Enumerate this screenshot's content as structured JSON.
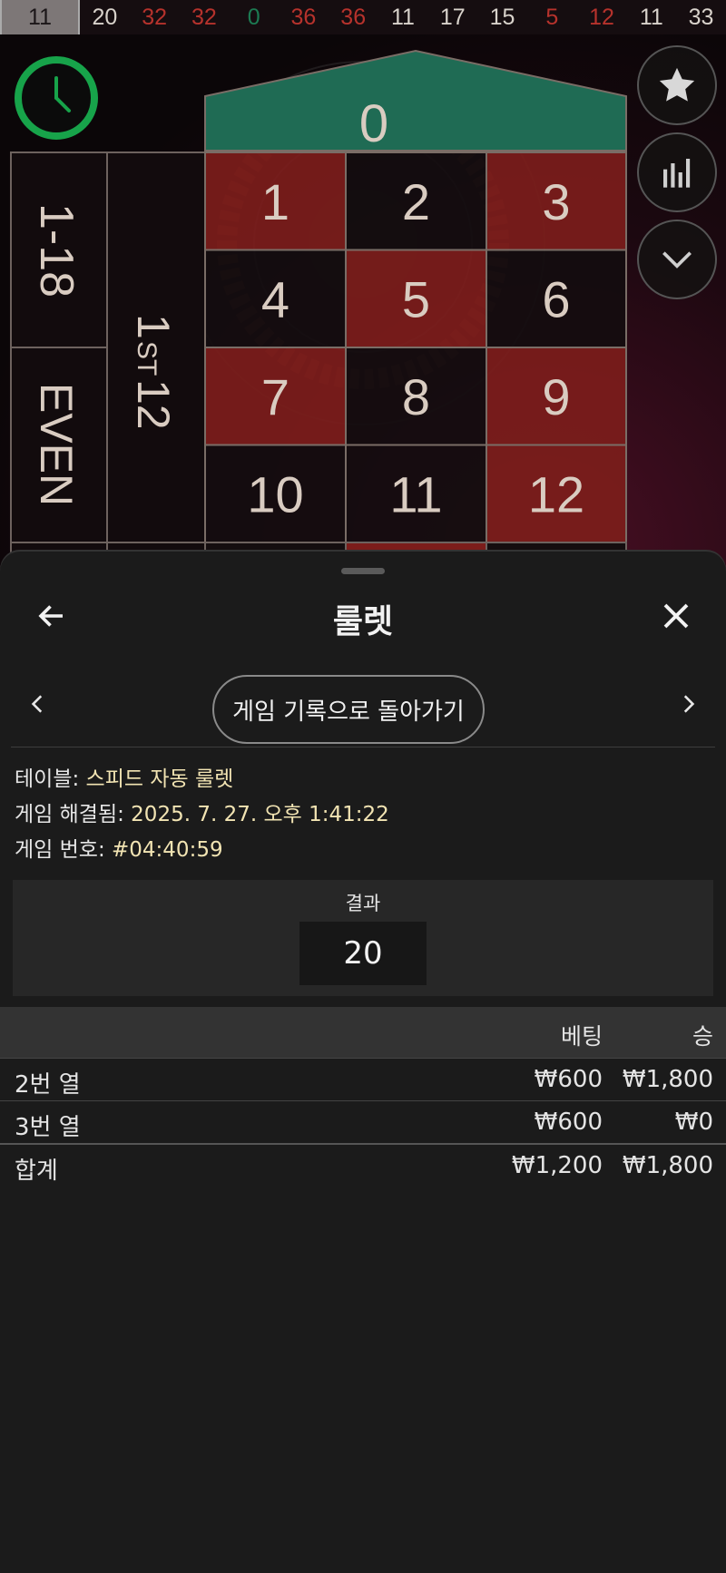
{
  "history": {
    "numbers": [
      {
        "value": "11",
        "color": "black"
      },
      {
        "value": "20",
        "color": "black"
      },
      {
        "value": "32",
        "color": "red"
      },
      {
        "value": "32",
        "color": "red"
      },
      {
        "value": "0",
        "color": "green"
      },
      {
        "value": "36",
        "color": "red"
      },
      {
        "value": "36",
        "color": "red"
      },
      {
        "value": "11",
        "color": "black"
      },
      {
        "value": "17",
        "color": "black"
      },
      {
        "value": "15",
        "color": "black"
      },
      {
        "value": "5",
        "color": "red"
      },
      {
        "value": "12",
        "color": "red"
      },
      {
        "value": "11",
        "color": "black"
      },
      {
        "value": "33",
        "color": "black"
      }
    ]
  },
  "table": {
    "zero": "0",
    "numbers": [
      {
        "n": "1",
        "color": "red"
      },
      {
        "n": "2",
        "color": "black"
      },
      {
        "n": "3",
        "color": "red"
      },
      {
        "n": "4",
        "color": "black"
      },
      {
        "n": "5",
        "color": "red"
      },
      {
        "n": "6",
        "color": "black"
      },
      {
        "n": "7",
        "color": "red"
      },
      {
        "n": "8",
        "color": "black"
      },
      {
        "n": "9",
        "color": "red"
      },
      {
        "n": "10",
        "color": "black"
      },
      {
        "n": "11",
        "color": "black"
      },
      {
        "n": "12",
        "color": "red"
      }
    ],
    "outside_low": "1-18",
    "outside_even": "EVEN",
    "dozen_number": "1",
    "dozen_suffix": "ST",
    "dozen_rest": "12",
    "colors": {
      "red": "#7c1d1b",
      "black": "#140d0f",
      "green": "#1f6b54",
      "accent": "#17a34a"
    }
  },
  "side_buttons": [
    "star-icon",
    "statistics-icon",
    "chevron-down-icon"
  ],
  "sheet": {
    "title": "룰렛",
    "back_to_history": "게임 기록으로 돌아가기",
    "info": {
      "table_label": "테이블: ",
      "table_value": "스피드 자동 룰렛",
      "resolved_label": "게임 해결됨: ",
      "resolved_value": "2025. 7. 27. 오후 1:41:22",
      "game_no_label": "게임 번호: ",
      "game_no_value": "#04:40:59"
    },
    "result_label": "결과",
    "result_value": "20",
    "bets": {
      "header_bet": "베팅",
      "header_win": "승",
      "rows": [
        {
          "name": "2번 열",
          "bet": "₩600",
          "win": "₩1,800"
        },
        {
          "name": "3번 열",
          "bet": "₩600",
          "win": "₩0"
        }
      ],
      "total": {
        "name": "합계",
        "bet": "₩1,200",
        "win": "₩1,800"
      }
    }
  }
}
